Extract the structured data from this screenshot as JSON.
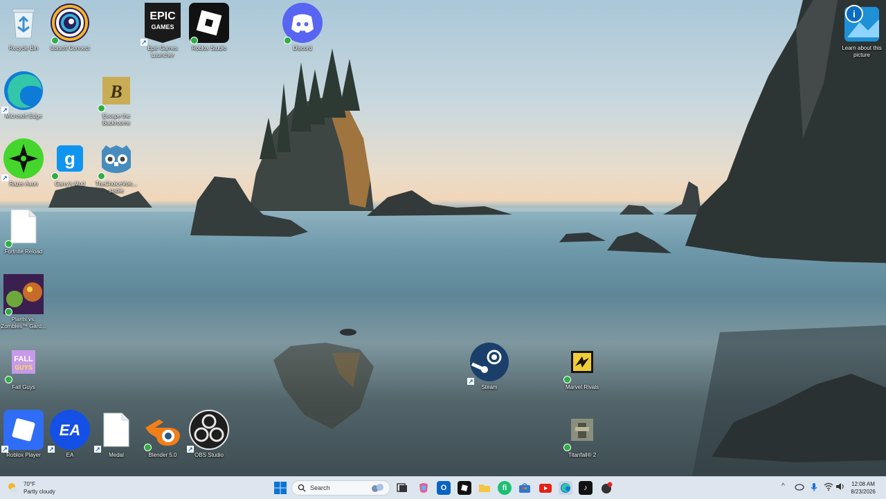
{
  "desktop": {
    "learn": "Learn about this picture",
    "icons": [
      {
        "label": "Recycle Bin"
      },
      {
        "label": "Ubisoft Connect"
      },
      {
        "label": "Epic Games Launcher"
      },
      {
        "label": "Roblox Studio"
      },
      {
        "label": "Discord"
      },
      {
        "label": "Microsoft Edge"
      },
      {
        "label": "Escape the Backrooms"
      },
      {
        "label": "Razer Axon"
      },
      {
        "label": "Garry's Mod"
      },
      {
        "label": "TheChoiceVoic... stable"
      },
      {
        "label": "Fortnite Reload"
      },
      {
        "label": "Plants vs. Zombies™ Gard..."
      },
      {
        "label": "Fall Guys"
      },
      {
        "label": "Steam"
      },
      {
        "label": "Marvel Rivals"
      },
      {
        "label": "Titanfall® 2"
      },
      {
        "label": "Roblox Player"
      },
      {
        "label": "EA"
      },
      {
        "label": "Medal"
      },
      {
        "label": "Blender 5.0"
      },
      {
        "label": "OBS Studio"
      }
    ]
  },
  "taskbar": {
    "weather_temp": "70°F",
    "weather_desc": "Partly cloudy",
    "search_placeholder": "Search",
    "time": "12:08 AM",
    "date": "8/23/2026"
  },
  "colors": {
    "accent": "#0067c0",
    "taskbar": "#dde6ee"
  }
}
